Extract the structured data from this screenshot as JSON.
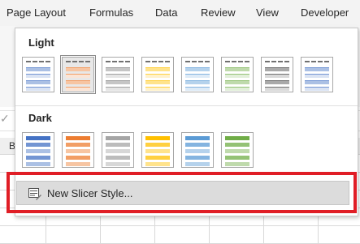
{
  "ribbon": {
    "tabs": [
      {
        "label": "Page Layout"
      },
      {
        "label": "Formulas"
      },
      {
        "label": "Data"
      },
      {
        "label": "Review"
      },
      {
        "label": "View"
      },
      {
        "label": "Developer"
      }
    ]
  },
  "sheet": {
    "check_glyph": "✓",
    "column_b": "B"
  },
  "gallery": {
    "light": {
      "label": "Light",
      "swatches": [
        {
          "color": "#4472c4",
          "selected": false
        },
        {
          "color": "#ed7d31",
          "selected": true
        },
        {
          "color": "#7f7f7f",
          "selected": false
        },
        {
          "color": "#ffc000",
          "selected": false
        },
        {
          "color": "#5b9bd5",
          "selected": false
        },
        {
          "color": "#70ad47",
          "selected": false
        },
        {
          "color": "#404040",
          "selected": false
        },
        {
          "color": "#4472c4",
          "selected": false
        }
      ]
    },
    "dark": {
      "label": "Dark",
      "swatches": [
        {
          "color": "#4472c4"
        },
        {
          "color": "#ed7d31"
        },
        {
          "color": "#a5a5a5"
        },
        {
          "color": "#ffc000"
        },
        {
          "color": "#5b9bd5"
        },
        {
          "color": "#70ad47"
        }
      ]
    },
    "new_style_label": "New Slicer Style..."
  },
  "highlight_color": "#e01e26"
}
